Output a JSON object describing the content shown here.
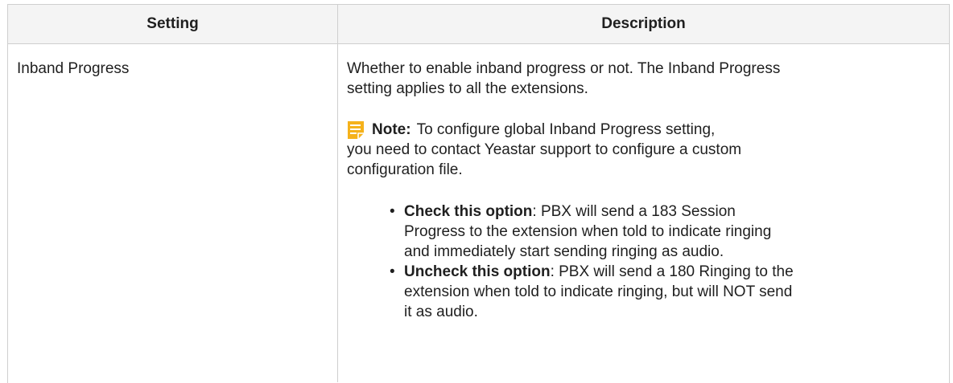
{
  "table": {
    "headers": {
      "setting": "Setting",
      "description": "Description"
    },
    "rows": [
      {
        "setting": "Inband Progress",
        "description": {
          "line1": "Whether to enable inband progress or not. The Inband Progress",
          "line2": "setting applies to all the extensions.",
          "note": {
            "icon": "note-icon",
            "icon_color": "#f5b21b",
            "label": "Note:",
            "line1": "To configure global Inband Progress setting,",
            "line2": "you need to contact Yeastar support to configure a custom",
            "line3": "configuration file."
          },
          "bullets": [
            {
              "bullet": "•",
              "strong": "Check this option",
              "line1": ": PBX will send a 183 Session",
              "line2": "Progress to the extension when told to indicate ringing",
              "line3": "and immediately start sending ringing as audio."
            },
            {
              "bullet": "•",
              "strong": "Uncheck this option",
              "line1": ": PBX will send a 180 Ringing to the",
              "line2": "extension when told to indicate ringing, but will NOT send",
              "line3": "it as audio."
            }
          ]
        }
      }
    ]
  }
}
